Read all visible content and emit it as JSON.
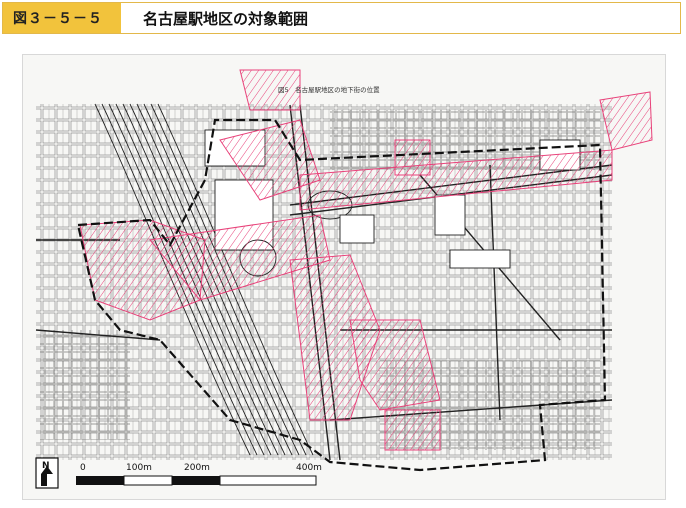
{
  "header": {
    "figure_number": "図３－５－５",
    "title": "名古屋駅地区の対象範囲"
  },
  "map": {
    "map_caption": "図5　名古屋駅地区の地下街の位置",
    "scale_labels": [
      "0",
      "100m",
      "200m",
      "400m"
    ],
    "north_label": "N",
    "colors": {
      "underground": "#e8427a",
      "boundary": "#111111",
      "street": "#333333",
      "header_accent": "#f2c33c"
    }
  }
}
